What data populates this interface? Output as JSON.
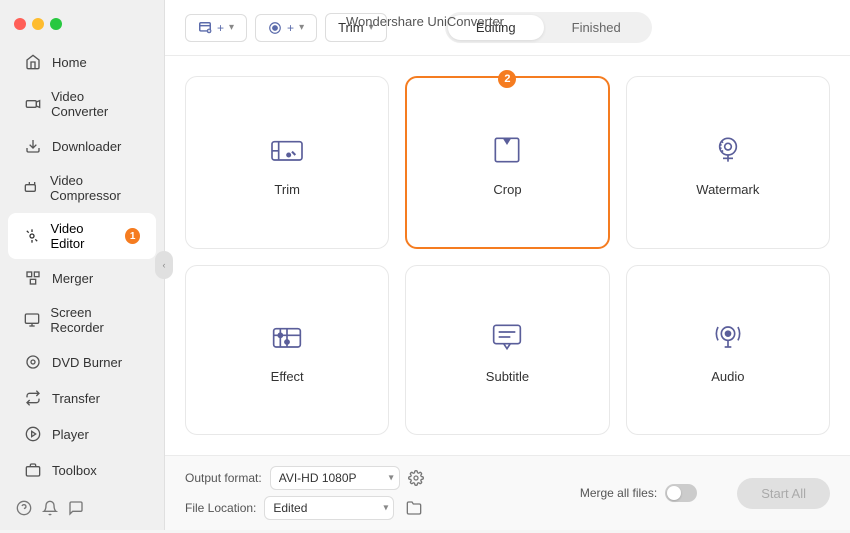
{
  "window": {
    "title": "Wondershare UniConverter"
  },
  "window_icons": {
    "user_icon": "👤",
    "notification_icon": "🔔"
  },
  "sidebar": {
    "items": [
      {
        "id": "home",
        "label": "Home",
        "icon": "house"
      },
      {
        "id": "video-converter",
        "label": "Video Converter",
        "icon": "video"
      },
      {
        "id": "downloader",
        "label": "Downloader",
        "icon": "download"
      },
      {
        "id": "video-compressor",
        "label": "Video Compressor",
        "icon": "compress"
      },
      {
        "id": "video-editor",
        "label": "Video Editor",
        "icon": "scissor",
        "active": true,
        "badge": "1"
      },
      {
        "id": "merger",
        "label": "Merger",
        "icon": "merge"
      },
      {
        "id": "screen-recorder",
        "label": "Screen Recorder",
        "icon": "screen"
      },
      {
        "id": "dvd-burner",
        "label": "DVD Burner",
        "icon": "dvd"
      },
      {
        "id": "transfer",
        "label": "Transfer",
        "icon": "transfer"
      },
      {
        "id": "player",
        "label": "Player",
        "icon": "play"
      },
      {
        "id": "toolbox",
        "label": "Toolbox",
        "icon": "toolbox"
      }
    ],
    "bottom_icons": [
      "help",
      "bell",
      "refresh"
    ]
  },
  "topbar": {
    "add_btn_label": "+",
    "record_btn_label": "⊕",
    "trim_label": "Trim",
    "tabs": [
      {
        "id": "editing",
        "label": "Editing",
        "active": true
      },
      {
        "id": "finished",
        "label": "Finished",
        "active": false
      }
    ]
  },
  "tools": [
    {
      "id": "trim",
      "label": "Trim",
      "badge": null
    },
    {
      "id": "crop",
      "label": "Crop",
      "badge": "2",
      "highlighted": true
    },
    {
      "id": "watermark",
      "label": "Watermark",
      "badge": null
    },
    {
      "id": "effect",
      "label": "Effect",
      "badge": null
    },
    {
      "id": "subtitle",
      "label": "Subtitle",
      "badge": null
    },
    {
      "id": "audio",
      "label": "Audio",
      "badge": null
    }
  ],
  "footer": {
    "output_format_label": "Output format:",
    "output_format_value": "AVI-HD 1080P",
    "file_location_label": "File Location:",
    "file_location_value": "Edited",
    "merge_label": "Merge all files:",
    "start_btn_label": "Start All"
  }
}
